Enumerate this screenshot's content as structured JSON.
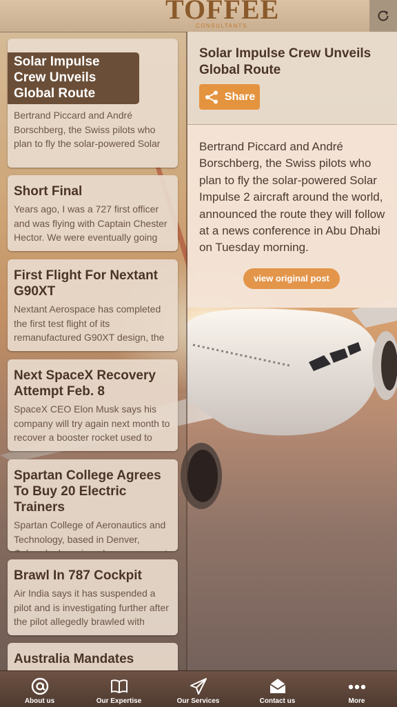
{
  "header": {
    "logo_text": "TOFFEE",
    "logo_sub": "CONSULTANTS",
    "refresh_icon": "refresh-icon"
  },
  "articles": [
    {
      "title": "Solar Impulse Crew Unveils Global Route",
      "desc": "Bertrand Piccard and André Borschberg, the Swiss pilots who plan to fly the solar-powered Solar"
    },
    {
      "title": "Short Final",
      "desc": "Years ago, I was a 727 first officer and was flying with Captain Chester Hector. We were eventually going"
    },
    {
      "title": "First Flight For Nextant G90XT",
      "desc": "Nextant Aerospace has completed the first test flight of its remanufactured G90XT design, the"
    },
    {
      "title": "Next SpaceX Recovery Attempt Feb. 8",
      "desc": "SpaceX CEO Elon Musk says his company will try again next month to recover a booster rocket used to"
    },
    {
      "title": "Spartan College Agrees To Buy 20 Electric Trainers",
      "desc": "Spartan College of Aeronautics and Technology, based in Denver, Colorado, has signed an agreement"
    },
    {
      "title": "Brawl In 787 Cockpit",
      "desc": "Air India says it has suspended a pilot and is investigating further after the pilot allegedly brawled with"
    },
    {
      "title": "Australia Mandates",
      "desc": ""
    }
  ],
  "detail": {
    "title": "Solar Impulse Crew Unveils Global Route",
    "share_label": "Share",
    "body": "Bertrand Piccard and André Borschberg, the Swiss pilots who plan to fly the solar-powered Solar Impulse 2 aircraft around the world, announced the route they will follow at a news conference in Abu Dhabi on Tuesday morning.",
    "view_label": "view original post"
  },
  "tabs": [
    {
      "label": "About us",
      "icon": "at-icon"
    },
    {
      "label": "Our Expertise",
      "icon": "book-icon"
    },
    {
      "label": "Our Services",
      "icon": "paper-plane-icon"
    },
    {
      "label": "Contact us",
      "icon": "envelope-icon"
    },
    {
      "label": "More",
      "icon": "more-icon"
    }
  ],
  "colors": {
    "accent": "#e4933f",
    "active_title_bg": "#6b4e37",
    "tabbar": "#5a4438"
  }
}
